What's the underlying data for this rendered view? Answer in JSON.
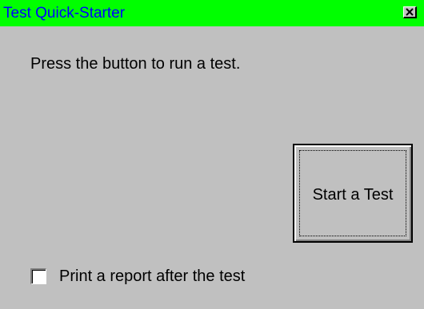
{
  "window": {
    "title": "Test Quick-Starter",
    "close_icon": "close-icon"
  },
  "main": {
    "instruction": "Press the button to run a test.",
    "start_button_label": "Start a Test",
    "print_report_label": "Print a report after the test",
    "print_report_checked": false
  },
  "colors": {
    "titlebar_bg": "#00ff00",
    "title_text": "#0000ff",
    "window_bg": "#c0c0c0"
  }
}
